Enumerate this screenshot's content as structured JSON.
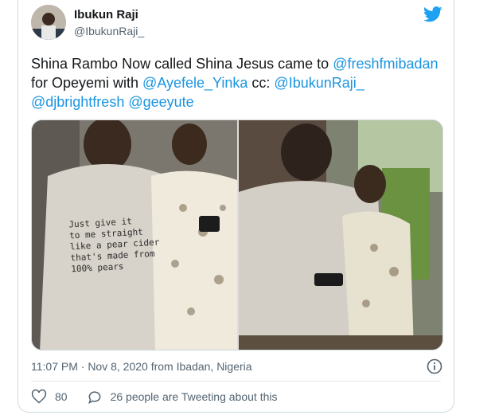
{
  "tweet": {
    "author_name": "Ibukun Raji",
    "author_handle": "@IbukunRaji_",
    "text_parts": [
      {
        "t": "Shina Rambo Now called Shina Jesus came to ",
        "m": false
      },
      {
        "t": "@freshfmibadan",
        "m": true
      },
      {
        "t": " for Opeyemi with ",
        "m": false
      },
      {
        "t": "@Ayefele_Yinka",
        "m": true
      },
      {
        "t": " cc: ",
        "m": false
      },
      {
        "t": "@IbukunRaji_",
        "m": true
      },
      {
        "t": " ",
        "m": false
      },
      {
        "t": "@djbrightfresh",
        "m": true
      },
      {
        "t": " ",
        "m": false
      },
      {
        "t": "@geeyute",
        "m": true
      }
    ],
    "shirt_text": [
      "Just give it",
      "to me straight",
      "like a pear cider",
      "that's made from",
      "100% pears"
    ],
    "timestamp": "11:07 PM · Nov 8, 2020 from Ibadan, Nigeria",
    "likes": "80",
    "tweeting_label": "26 people are Tweeting about this"
  },
  "icons": {
    "brand": "twitter-bird-icon",
    "info": "info-icon",
    "like": "heart-icon",
    "reply": "speech-bubble-icon"
  },
  "colors": {
    "brand": "#1da1f2",
    "mention": "#1b95e0",
    "secondary_text": "#536471"
  }
}
